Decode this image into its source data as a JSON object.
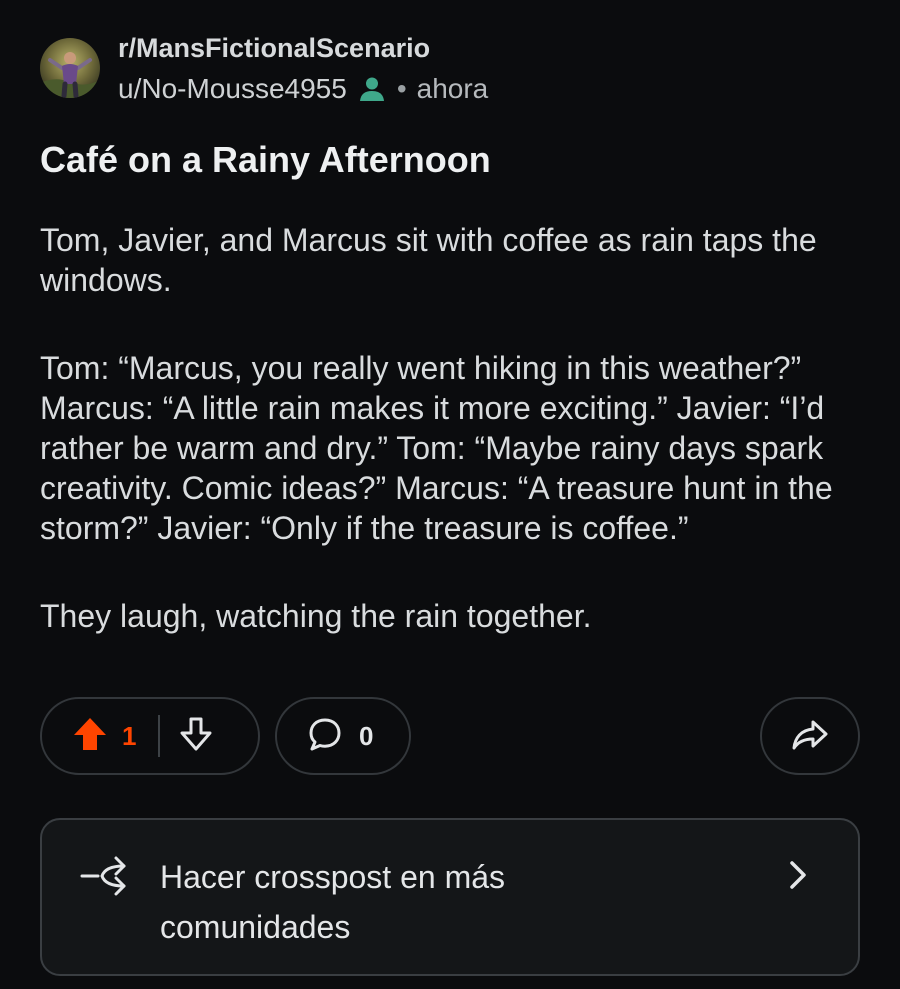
{
  "header": {
    "subreddit": "r/MansFictionalScenario",
    "username": "u/No-Mousse4955",
    "separator": "•",
    "time": "ahora"
  },
  "post": {
    "title": "Café on a Rainy Afternoon",
    "paragraphs": [
      "Tom, Javier, and Marcus sit with coffee as rain taps the windows.",
      "Tom: “Marcus, you really went hiking in this weather?” Marcus: “A little rain makes it more exciting.” Javier: “I’d rather be warm and dry.” Tom: “Maybe rainy days spark creativity. Comic ideas?” Marcus: “A treasure hunt in the storm?” Javier: “Only if the treasure is coffee.”",
      "They laugh, watching the rain together."
    ]
  },
  "actions": {
    "upvote_count": "1",
    "comment_count": "0"
  },
  "crosspost": {
    "label": "Hacer crosspost en más comunidades"
  },
  "colors": {
    "background": "#0b0c0e",
    "upvote_orange": "#ff4500",
    "user_icon_teal": "#3fa88a",
    "pill_border": "#33373b"
  },
  "icons": {
    "avatar": "user-avatar",
    "user_badge": "person-icon",
    "upvote": "arrow-up-icon",
    "downvote": "arrow-down-icon",
    "comment": "speech-bubble-icon",
    "share": "share-arrow-icon",
    "crosspost": "crosspost-icon",
    "chevron": "chevron-right-icon"
  }
}
